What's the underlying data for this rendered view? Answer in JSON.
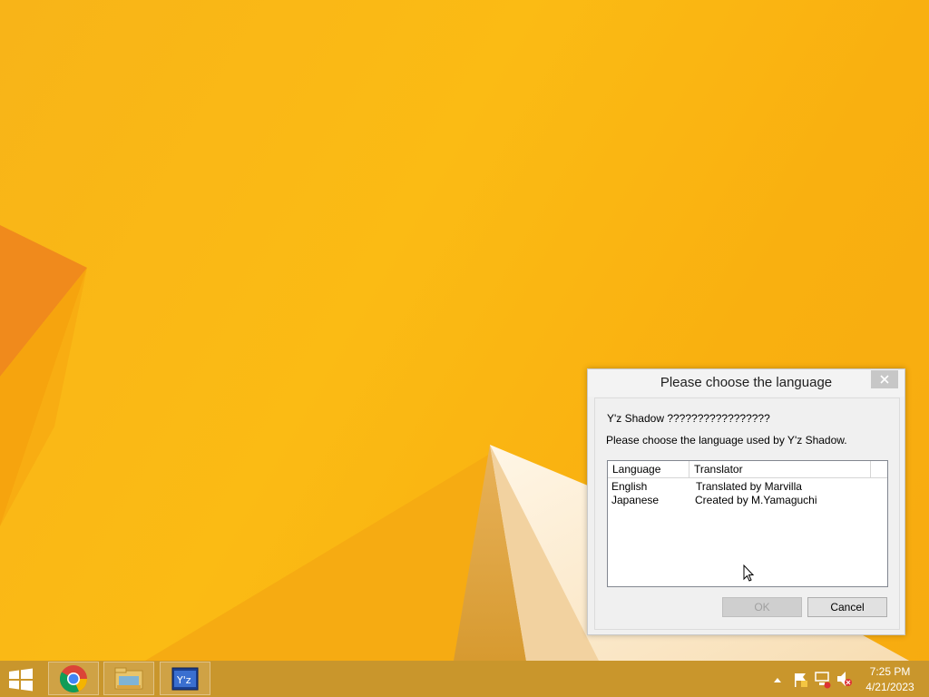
{
  "dialog": {
    "title": "Please choose the language",
    "line1": "Y'z Shadow ?????????????????",
    "line2": "Please choose the language used by Y'z Shadow.",
    "columns": [
      "Language",
      "Translator"
    ],
    "rows": [
      {
        "language": "English",
        "translator": "Translated by Marvilla"
      },
      {
        "language": "Japanese",
        "translator": "Created by M.Yamaguchi"
      }
    ],
    "ok_label": "OK",
    "cancel_label": "Cancel"
  },
  "taskbar": {
    "items": [
      "chrome-icon",
      "file-explorer-icon",
      "yz-shadow-icon"
    ],
    "clock_time": "7:25 PM",
    "clock_date": "4/21/2023"
  },
  "colors": {
    "desktop": "#f9b614",
    "taskbar": "#c9962c"
  }
}
